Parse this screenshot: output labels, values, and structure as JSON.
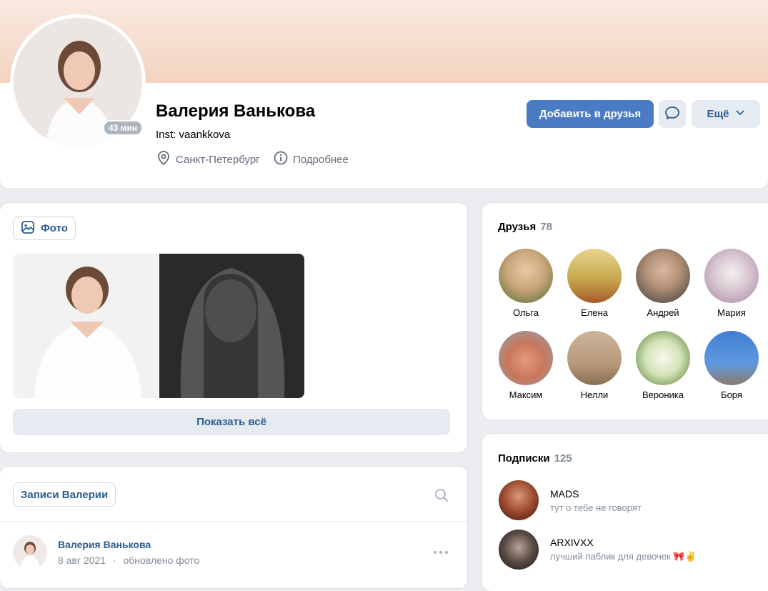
{
  "profile": {
    "name": "Валерия Ванькова",
    "status": "Inst: vaankkova",
    "last_seen": "43 мин",
    "city": "Санкт-Петербург",
    "details_label": "Подробнее"
  },
  "actions": {
    "add_friend": "Добавить в друзья",
    "more": "Ещё"
  },
  "photos": {
    "tab_label": "Фото",
    "show_all": "Показать всё"
  },
  "friends": {
    "title": "Друзья",
    "count": "78",
    "items": [
      {
        "name": "Ольга"
      },
      {
        "name": "Елена"
      },
      {
        "name": "Андрей"
      },
      {
        "name": "Мария"
      },
      {
        "name": "Максим"
      },
      {
        "name": "Нелли"
      },
      {
        "name": "Вероника"
      },
      {
        "name": "Боря"
      }
    ]
  },
  "subscriptions": {
    "title": "Подписки",
    "count": "125",
    "items": [
      {
        "name": "MADS",
        "desc": "тут о тебе не говорят"
      },
      {
        "name": "ARXIVXX",
        "desc": "лучший паблик для девочек 🎀✌"
      }
    ]
  },
  "wall": {
    "tab_label": "Записи Валерии",
    "post": {
      "author": "Валерия Ванькова",
      "date": "8 авг 2021",
      "separator": "·",
      "action": "обновлено фото"
    }
  }
}
